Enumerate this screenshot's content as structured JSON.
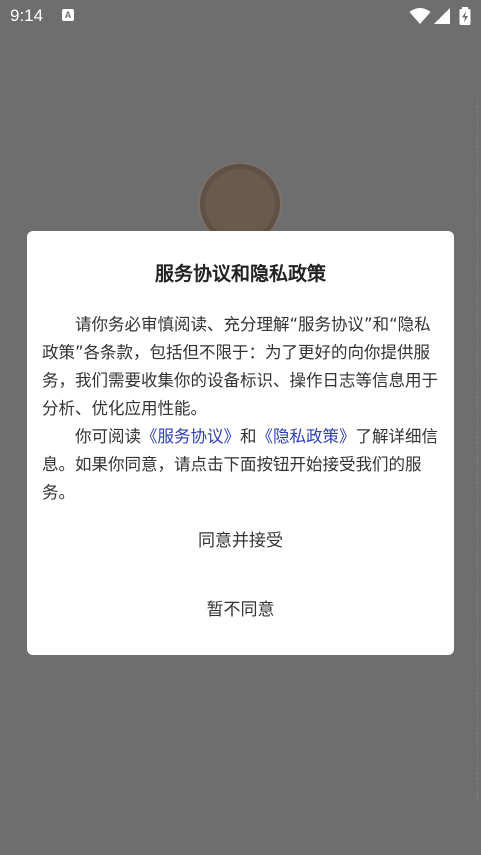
{
  "status_bar": {
    "time": "9:14",
    "notification_icon": "A"
  },
  "icons": {
    "wifi": "wifi-icon",
    "signal": "signal-icon",
    "battery": "battery-charging-icon"
  },
  "dialog": {
    "title": "服务协议和隐私政策",
    "para1": "请你务必审慎阅读、充分理解“服务协议”和“隐私政策”各条款，包括但不限于：为了更好的向你提供服务，我们需要收集你的设备标识、操作日志等信息用于分析、优化应用性能。",
    "para2_prefix": "你可阅读",
    "service_link": "《服务协议》",
    "para2_and": "和",
    "privacy_link": "《隐私政策》",
    "para2_suffix": "了解详细信息。如果你同意，请点击下面按钮开始接受我们的服务。",
    "agree_button": "同意并接受",
    "decline_button": "暂不同意"
  },
  "colors": {
    "overlay": "#6e6e6e",
    "link": "#2d3fb5",
    "text": "#333333"
  }
}
